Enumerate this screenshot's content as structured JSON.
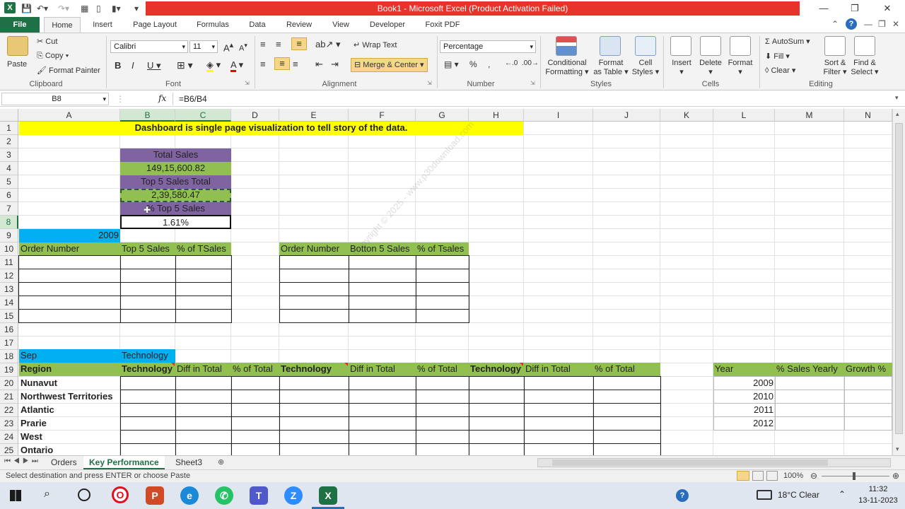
{
  "window": {
    "title": "Book1  -  Microsoft Excel (Product Activation Failed)"
  },
  "ribbon_tabs": [
    "File",
    "Home",
    "Insert",
    "Page Layout",
    "Formulas",
    "Data",
    "Review",
    "View",
    "Developer",
    "Foxit PDF"
  ],
  "ribbon": {
    "clipboard": {
      "paste": "Paste",
      "cut": "Cut",
      "copy": "Copy",
      "format_painter": "Format Painter",
      "label": "Clipboard"
    },
    "font": {
      "name": "Calibri",
      "size": "11",
      "label": "Font"
    },
    "alignment": {
      "wrap_text": "Wrap Text",
      "merge_center": "Merge & Center",
      "label": "Alignment"
    },
    "number": {
      "format": "Percentage",
      "label": "Number"
    },
    "styles": {
      "conditional": "Conditional",
      "conditional2": "Formatting",
      "format_as": "Format",
      "format_as2": "as Table",
      "cell": "Cell",
      "cell2": "Styles",
      "label": "Styles"
    },
    "cells": {
      "insert": "Insert",
      "delete": "Delete",
      "format": "Format",
      "label": "Cells"
    },
    "editing": {
      "autosum": "AutoSum",
      "fill": "Fill",
      "clear": "Clear",
      "sort": "Sort &",
      "sort2": "Filter",
      "find": "Find &",
      "find2": "Select",
      "label": "Editing"
    }
  },
  "formula_bar": {
    "name_box": "B8",
    "fx": "fx",
    "formula": "=B6/B4"
  },
  "columns": [
    "A",
    "B",
    "C",
    "D",
    "E",
    "F",
    "G",
    "H",
    "I",
    "J",
    "K",
    "L",
    "M",
    "N"
  ],
  "rows": [
    "1",
    "2",
    "3",
    "4",
    "5",
    "6",
    "7",
    "8",
    "9",
    "10",
    "11",
    "12",
    "13",
    "14",
    "15",
    "16",
    "17",
    "18",
    "19",
    "20",
    "21",
    "22",
    "23",
    "24",
    "25"
  ],
  "cells": {
    "r1_banner": "Dashboard is single page visualization to tell story of the data.",
    "b3": "Total Sales",
    "b4": "149,15,600.82",
    "b5": "Top 5 Sales Total",
    "b6": "2,39,580.47",
    "b7": "% Top 5 Sales",
    "b8": "1.61%",
    "a9": "2009",
    "a10": "Order Number",
    "b10": "Top 5 Sales",
    "c10": "% of TSales",
    "e10": "Order Number",
    "f10": "Botton 5 Sales",
    "g10": "% of Tsales",
    "a18": "Sep",
    "b18": "Technology",
    "a19": "Region",
    "b19": "Technology",
    "c19": "Diff in Total",
    "d19": "% of Total",
    "e19": "Technology",
    "f19": "Diff in Total",
    "g19": "% of Total",
    "h19": "Technology",
    "i19": "Diff in Total",
    "j19": "% of Total",
    "l19": "Year",
    "m19": "% Sales Yearly",
    "n19": "Growth %",
    "regions": [
      "Nunavut",
      "Northwest Territories",
      "Atlantic",
      "Prarie",
      "West",
      "Ontario"
    ],
    "years": [
      "2009",
      "2010",
      "2011",
      "2012"
    ]
  },
  "watermark": "Copyright © 2025 - www.p30download.com",
  "sheet_tabs": [
    "Orders",
    "Key Performance",
    "Sheet3"
  ],
  "status": {
    "message": "Select destination and press ENTER or choose Paste",
    "zoom": "100%"
  },
  "taskbar": {
    "weather": "18°C  Clear",
    "time": "11:32",
    "date": "13-11-2023"
  },
  "colors": {
    "purple": "#8064a2",
    "green": "#92c050",
    "blue": "#00b0f0",
    "yellow": "#ffff00",
    "excel_green": "#1e7145"
  }
}
